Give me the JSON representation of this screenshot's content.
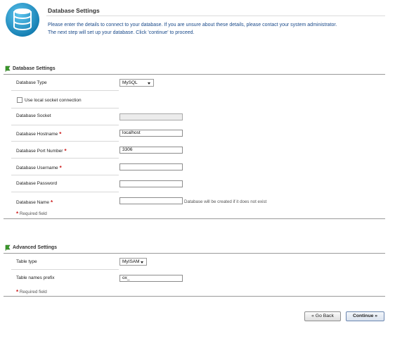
{
  "header": {
    "title": "Database Settings",
    "description_line1": "Please enter the details to connect to your database. If you are unsure about these details, please contact your system administrator.",
    "description_line2": "The next step will set up your database. Click 'continue' to proceed."
  },
  "database_section": {
    "title": "Database Settings",
    "db_type": {
      "label": "Database Type",
      "value": "MySQL"
    },
    "socket_checkbox": {
      "label": "Use local socket connection",
      "checked": false
    },
    "socket": {
      "label": "Database Socket",
      "value": ""
    },
    "hostname": {
      "label": "Database Hostname",
      "value": "localhost"
    },
    "port": {
      "label": "Database Port Number",
      "value": "3306"
    },
    "username": {
      "label": "Database Username",
      "value": ""
    },
    "password": {
      "label": "Database Password",
      "value": ""
    },
    "dbname": {
      "label": "Database Name",
      "value": "",
      "hint": "Database will be created if it does not exist"
    },
    "required_note": "Required field"
  },
  "advanced_section": {
    "title": "Advanced Settings",
    "table_type": {
      "label": "Table type",
      "value": "MyISAM"
    },
    "prefix": {
      "label": "Table names prefix",
      "value": "ox_"
    },
    "required_note": "Required field"
  },
  "buttons": {
    "back": "« Go Back",
    "continue": "Continue »"
  },
  "markers": {
    "required": "*"
  },
  "colors": {
    "link_text": "#1a4a8a",
    "required": "#cc1a1a",
    "section_icon": "#3a9a2a",
    "logo": "#1a8fc4"
  }
}
